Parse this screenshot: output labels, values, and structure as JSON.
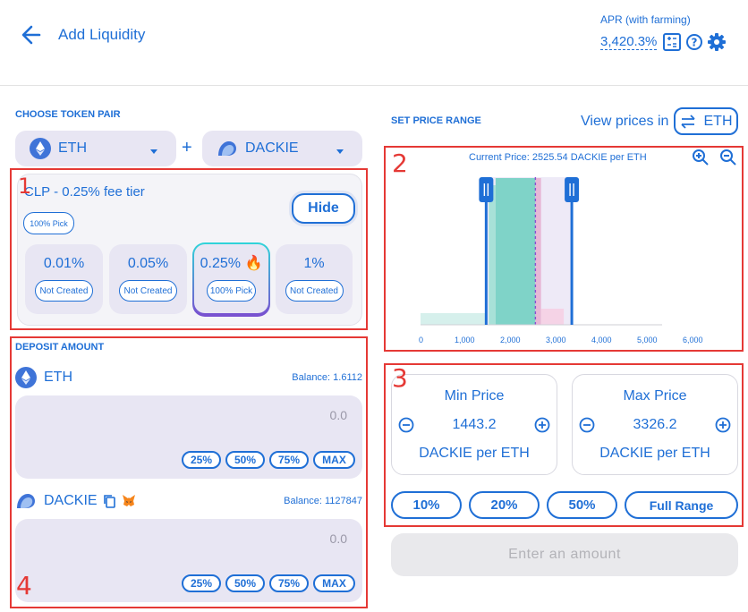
{
  "header": {
    "title": "Add Liquidity",
    "apr_label": "APR (with farming)",
    "apr_value": "3,420.3%"
  },
  "token_pair": {
    "label": "CHOOSE TOKEN PAIR",
    "token_a": "ETH",
    "plus": "+",
    "token_b": "DACKIE"
  },
  "fee": {
    "title": "CLP - 0.25% fee tier",
    "pick_badge": "100% Pick",
    "hide_label": "Hide",
    "tiers": [
      {
        "value": "0.01%",
        "badge": "Not Created"
      },
      {
        "value": "0.05%",
        "badge": "Not Created"
      },
      {
        "value": "0.25% 🔥",
        "badge": "100% Pick"
      },
      {
        "value": "1%",
        "badge": "Not Created"
      }
    ]
  },
  "deposit": {
    "label": "DEPOSIT AMOUNT",
    "token_a": {
      "name": "ETH",
      "balance": "Balance: 1.6112",
      "value": "0.0"
    },
    "token_b": {
      "name": "DACKIE",
      "balance": "Balance: 1127847",
      "value": "0.0"
    },
    "percent_buttons": [
      "25%",
      "50%",
      "75%",
      "MAX"
    ]
  },
  "price_range": {
    "label": "SET PRICE RANGE",
    "view_prices_in": "View prices in",
    "view_token": "ETH",
    "current_price": "Current Price: 2525.54 DACKIE per ETH",
    "x_ticks": [
      "0",
      "1,000",
      "2,000",
      "3,000",
      "4,000",
      "5,000",
      "6,000"
    ],
    "min": {
      "label": "Min Price",
      "value": "1443.2",
      "unit": "DACKIE per ETH"
    },
    "max": {
      "label": "Max Price",
      "value": "3326.2",
      "unit": "DACKIE per ETH"
    },
    "range_buttons": [
      "10%",
      "20%",
      "50%",
      "Full Range"
    ],
    "submit": "Enter an amount"
  },
  "annotations": [
    "1",
    "2",
    "3",
    "4"
  ],
  "chart_data": {
    "type": "area",
    "x_range": [
      0,
      6000
    ],
    "current_price": 2525.54,
    "range_min": 1443.2,
    "range_max": 3326.2
  },
  "colors": {
    "accent": "#1f6fd6",
    "annotation": "#e53935",
    "card": "#e8e6f3",
    "liquidity": "#7fd3c8",
    "liquidity_pink": "#f2a6cf"
  }
}
